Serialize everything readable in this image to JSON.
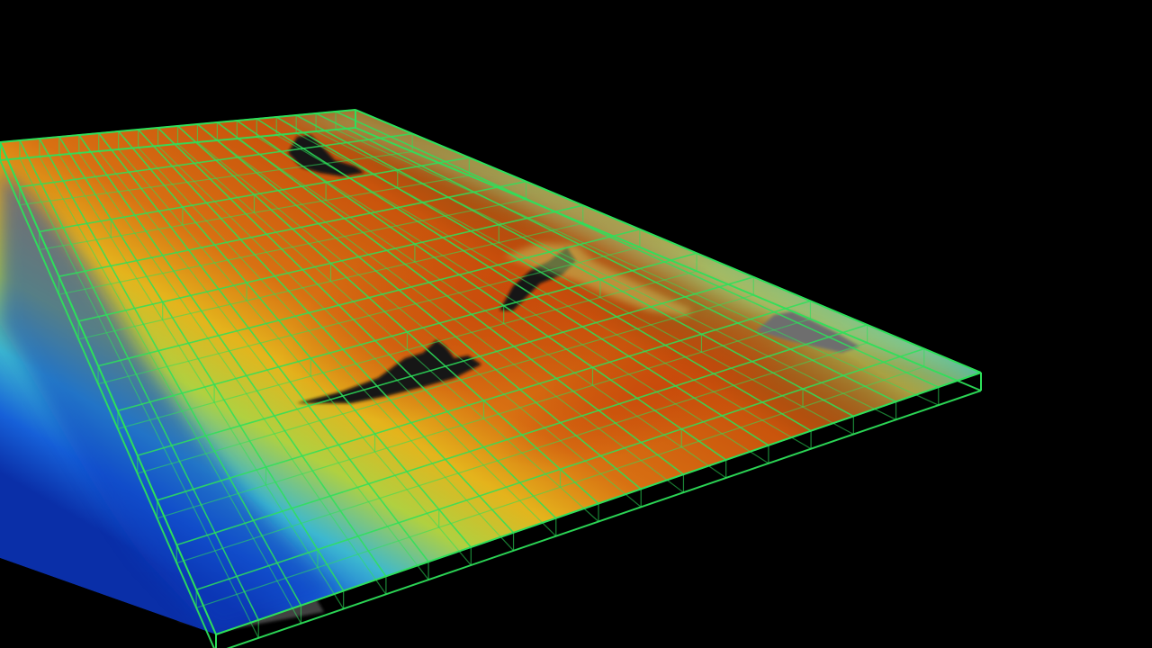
{
  "viewport": {
    "background": "#000000",
    "grid_color": "#2de05a"
  },
  "terrain": {
    "colormap": [
      "#0a3fbf",
      "#1e7fe0",
      "#3cd0c8",
      "#a8e050",
      "#e8b020",
      "#d86a10",
      "#c04a0c"
    ],
    "land_color": "#6a6a6a",
    "peak_color": "#1a1a1a"
  }
}
